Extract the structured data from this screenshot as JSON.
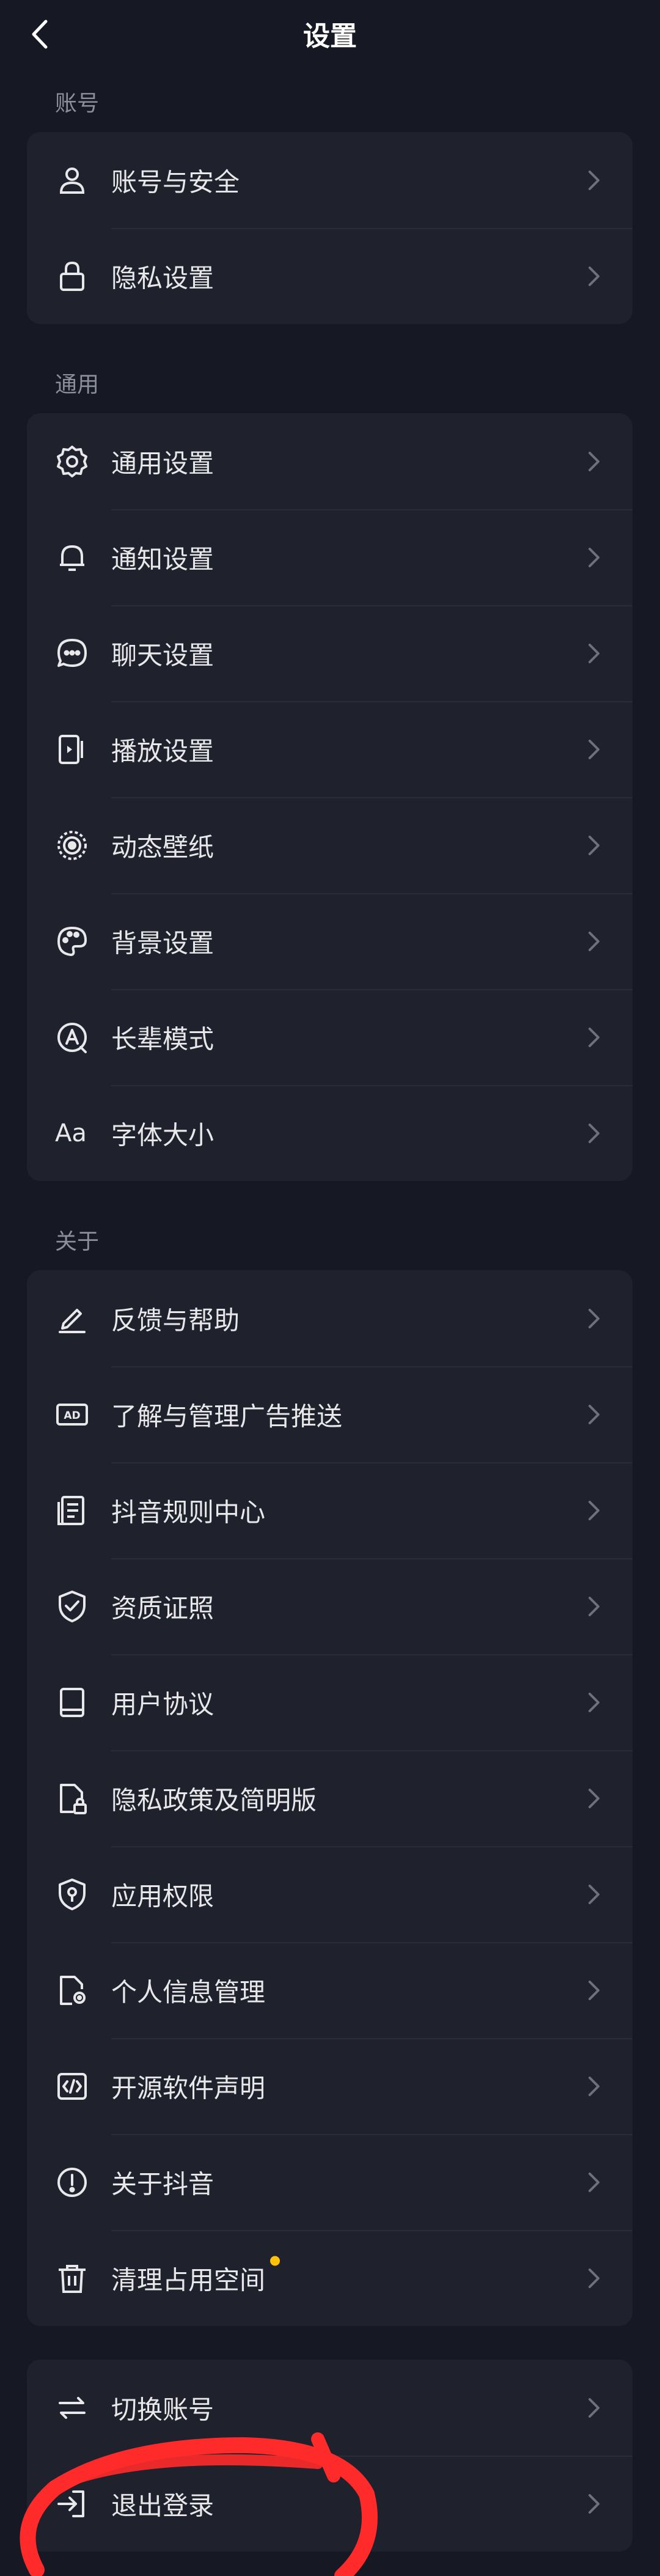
{
  "header": {
    "title": "设置"
  },
  "sections": {
    "account": {
      "title": "账号",
      "items": [
        {
          "label": "账号与安全",
          "icon": "user-icon"
        },
        {
          "label": "隐私设置",
          "icon": "lock-icon"
        }
      ]
    },
    "general": {
      "title": "通用",
      "items": [
        {
          "label": "通用设置",
          "icon": "gear-icon"
        },
        {
          "label": "通知设置",
          "icon": "bell-icon"
        },
        {
          "label": "聊天设置",
          "icon": "chat-icon"
        },
        {
          "label": "播放设置",
          "icon": "play-settings-icon"
        },
        {
          "label": "动态壁纸",
          "icon": "live-wallpaper-icon"
        },
        {
          "label": "背景设置",
          "icon": "palette-icon"
        },
        {
          "label": "长辈模式",
          "icon": "elder-mode-icon"
        },
        {
          "label": "字体大小",
          "icon": "font-size-icon",
          "icon_text": "Aa"
        }
      ]
    },
    "about": {
      "title": "关于",
      "items": [
        {
          "label": "反馈与帮助",
          "icon": "edit-icon"
        },
        {
          "label": "了解与管理广告推送",
          "icon": "ad-icon",
          "icon_text": "AD"
        },
        {
          "label": "抖音规则中心",
          "icon": "document-icon"
        },
        {
          "label": "资质证照",
          "icon": "shield-check-icon"
        },
        {
          "label": "用户协议",
          "icon": "book-icon"
        },
        {
          "label": "隐私政策及简明版",
          "icon": "file-lock-icon"
        },
        {
          "label": "应用权限",
          "icon": "location-shield-icon"
        },
        {
          "label": "个人信息管理",
          "icon": "file-settings-icon"
        },
        {
          "label": "开源软件声明",
          "icon": "code-icon"
        },
        {
          "label": "关于抖音",
          "icon": "info-icon"
        },
        {
          "label": "清理占用空间",
          "icon": "trash-icon",
          "badge": true
        }
      ]
    },
    "session": {
      "items": [
        {
          "label": "切换账号",
          "icon": "switch-icon"
        },
        {
          "label": "退出登录",
          "icon": "logout-icon"
        }
      ]
    }
  },
  "colors": {
    "background": "#161823",
    "card": "#1f212c",
    "badge": "#ffc107",
    "annotation": "#ff2a2a"
  }
}
